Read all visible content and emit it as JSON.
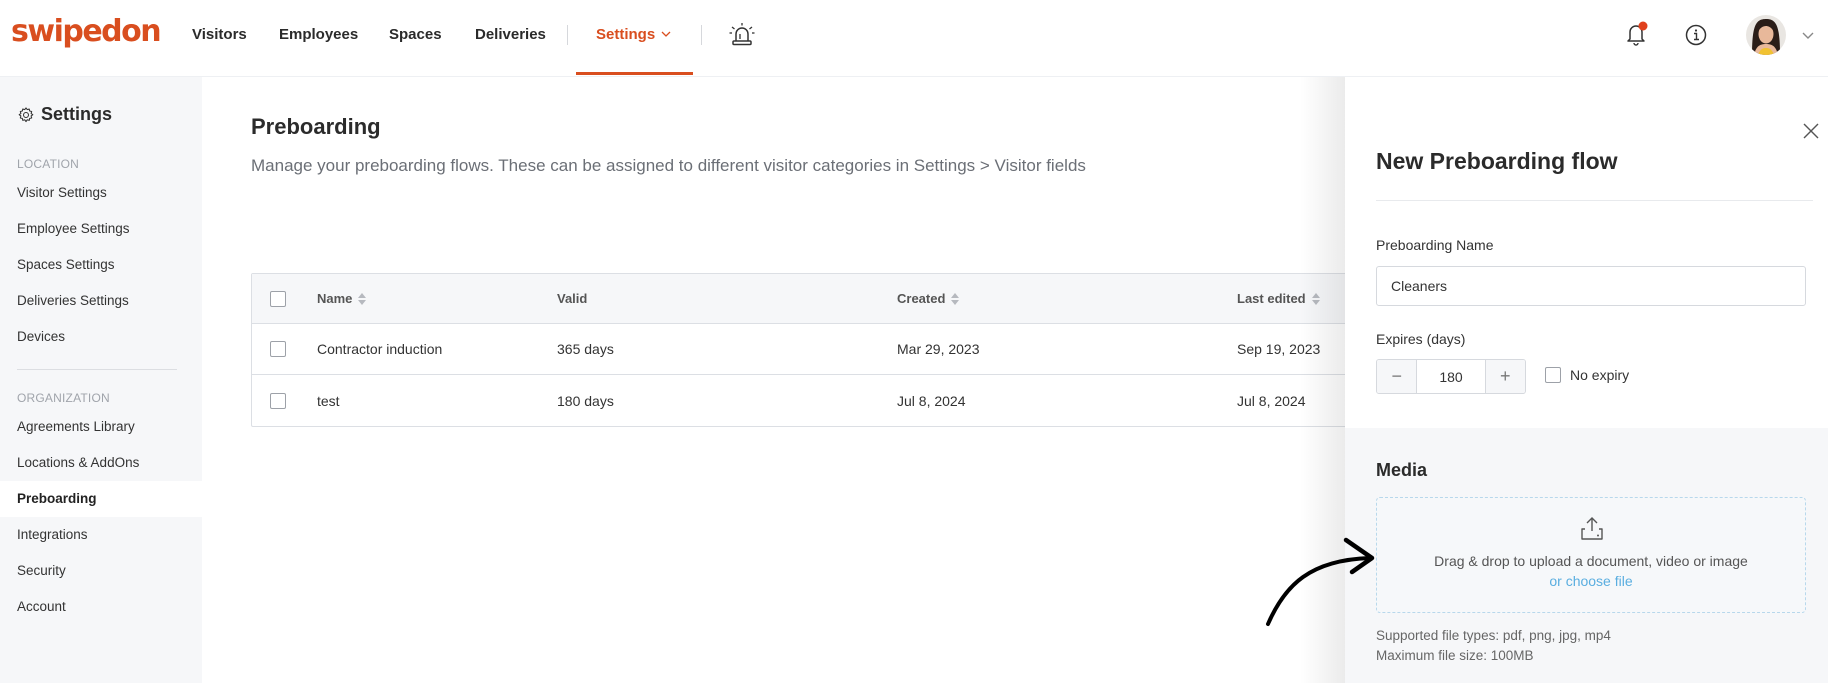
{
  "brand": {
    "logo_text": "swipedon",
    "accent_color": "#d94e1f"
  },
  "topnav": {
    "items": [
      {
        "label": "Visitors"
      },
      {
        "label": "Employees"
      },
      {
        "label": "Spaces"
      },
      {
        "label": "Deliveries"
      },
      {
        "label": "Settings",
        "active": true
      }
    ],
    "icons": [
      "alarm-icon",
      "bell-icon",
      "info-icon",
      "avatar",
      "chevron-down-icon"
    ],
    "notification_dot_color": "#e0401c"
  },
  "sidebar": {
    "title": "Settings",
    "sections": [
      {
        "label": "LOCATION",
        "items": [
          {
            "label": "Visitor Settings"
          },
          {
            "label": "Employee Settings"
          },
          {
            "label": "Spaces Settings"
          },
          {
            "label": "Deliveries Settings"
          },
          {
            "label": "Devices"
          }
        ]
      },
      {
        "label": "ORGANIZATION",
        "items": [
          {
            "label": "Agreements Library"
          },
          {
            "label": "Locations & AddOns"
          },
          {
            "label": "Preboarding",
            "active": true
          },
          {
            "label": "Integrations"
          },
          {
            "label": "Security"
          },
          {
            "label": "Account"
          }
        ]
      }
    ]
  },
  "main": {
    "title": "Preboarding",
    "description": "Manage your preboarding flows. These can be assigned to different visitor categories in Settings > Visitor fields",
    "table": {
      "columns": [
        {
          "label": "Name",
          "sortable": true
        },
        {
          "label": "Valid",
          "sortable": false
        },
        {
          "label": "Created",
          "sortable": true
        },
        {
          "label": "Last edited",
          "sortable": true
        }
      ],
      "rows": [
        {
          "name": "Contractor induction",
          "valid": "365 days",
          "created": "Mar 29, 2023",
          "last_edited": "Sep 19, 2023"
        },
        {
          "name": "test",
          "valid": "180 days",
          "created": "Jul 8, 2024",
          "last_edited": "Jul 8, 2024"
        }
      ]
    }
  },
  "drawer": {
    "title": "New Preboarding flow",
    "name_label": "Preboarding Name",
    "name_value": "Cleaners",
    "expires_label": "Expires (days)",
    "expires_value": "180",
    "decrement_symbol": "−",
    "increment_symbol": "+",
    "no_expiry_label": "No expiry",
    "no_expiry_checked": false,
    "media": {
      "title": "Media",
      "dropzone_text": "Drag & drop to upload a document, video or image",
      "choose_file_label": "or choose file",
      "supported_types": "Supported file types: pdf, png, jpg, mp4",
      "max_size": "Maximum file size: 100MB"
    }
  }
}
